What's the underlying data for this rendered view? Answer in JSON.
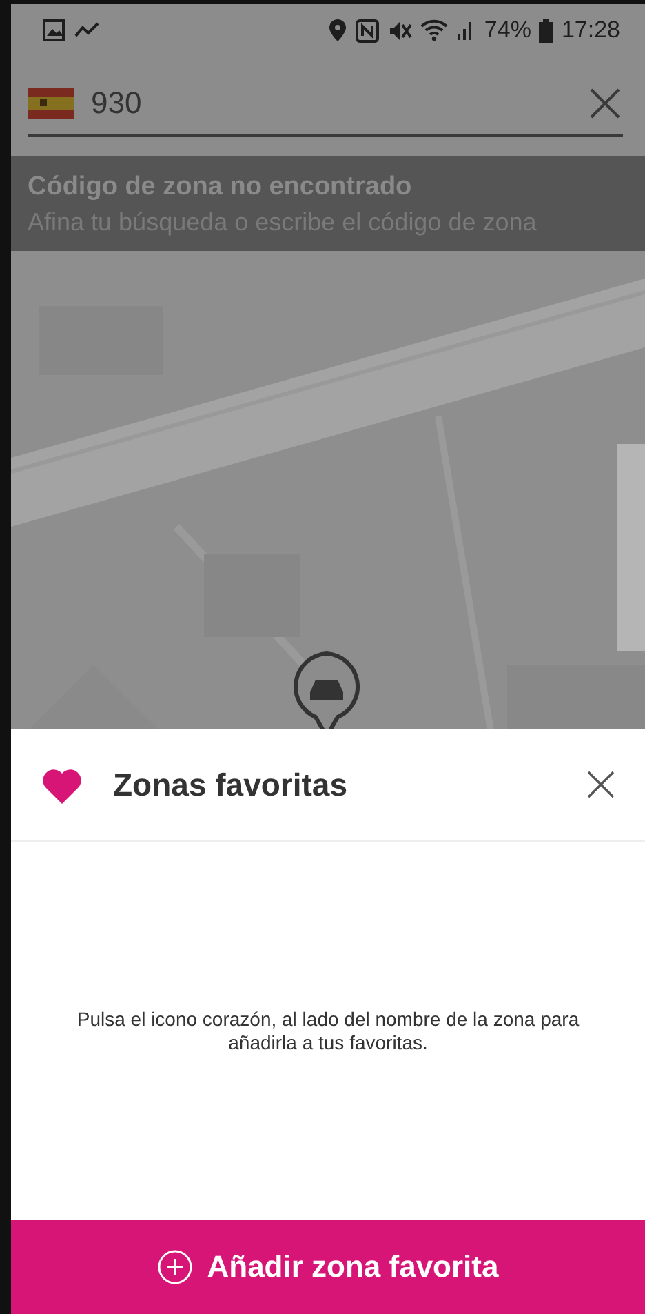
{
  "status_bar": {
    "battery": "74%",
    "time": "17:28"
  },
  "search": {
    "value": "930"
  },
  "error_banner": {
    "title": "Código de zona no encontrado",
    "message": "Afina tu búsqueda o escribe el código de zona"
  },
  "favorites_sheet": {
    "title": "Zonas favoritas",
    "empty_message": "Pulsa el icono corazón, al lado del nombre de la zona para añadirla a tus favoritas.",
    "add_button": "Añadir zona favorita"
  }
}
